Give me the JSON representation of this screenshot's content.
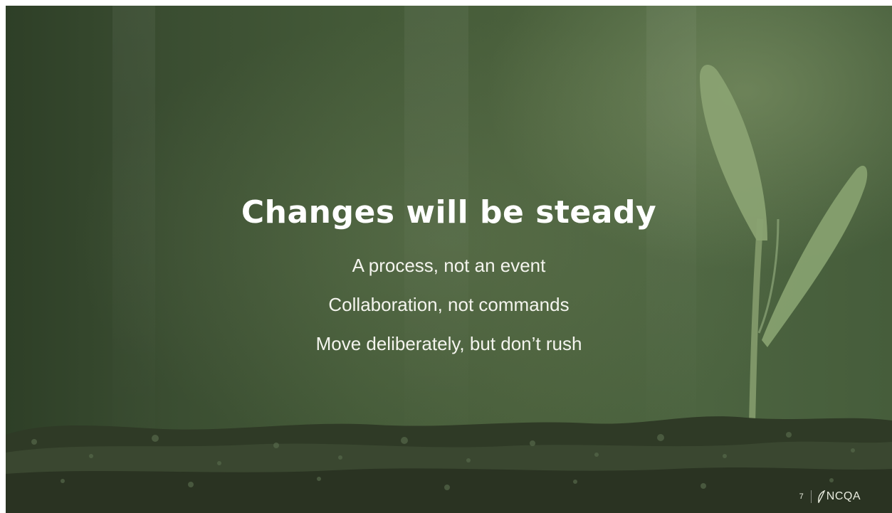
{
  "slide": {
    "title": "Changes will be steady",
    "bullets": [
      "A process, not an event",
      "Collaboration, not commands",
      "Move deliberately, but don’t rush"
    ],
    "page_number": "7",
    "logo_text": "NCQA"
  },
  "theme": {
    "background": "#445a38",
    "text": "#ffffff",
    "leaf": "#8fa577"
  }
}
